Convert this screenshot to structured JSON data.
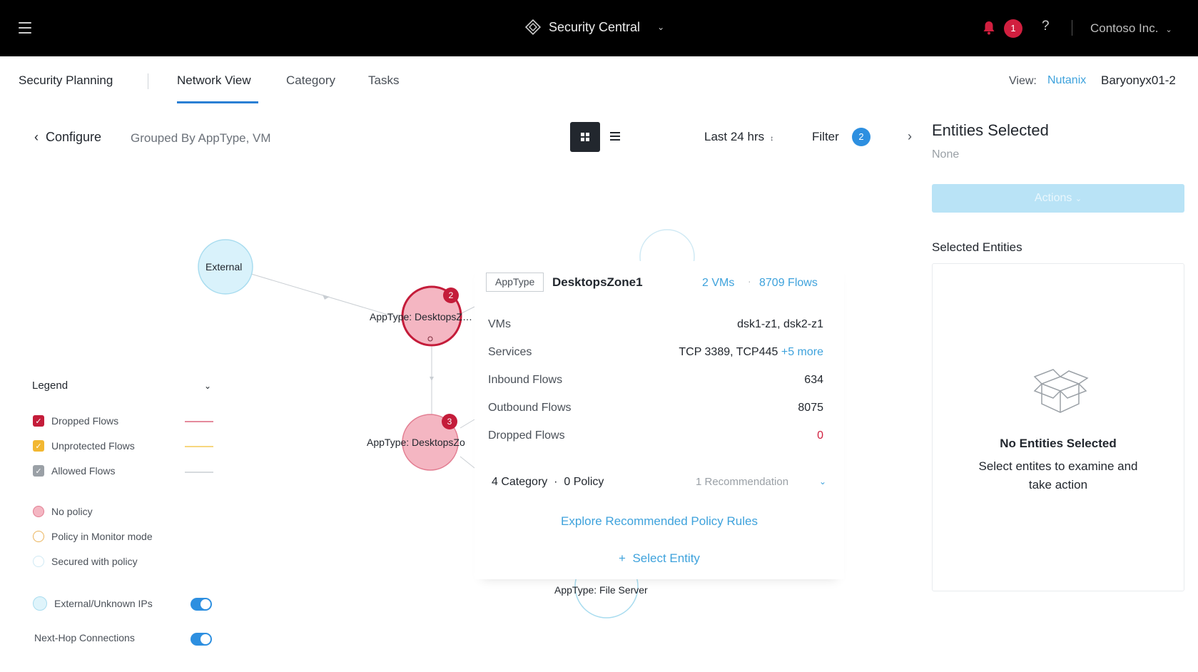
{
  "header": {
    "product": "Security Central",
    "alert_count": "1",
    "help": "?",
    "org": "Contoso Inc."
  },
  "nav": {
    "section": "Security Planning",
    "tabs": [
      "Network View",
      "Category",
      "Tasks"
    ],
    "active_tab": "Network View",
    "view_label": "View:",
    "view_provider": "Nutanix",
    "view_cluster": "Baryonyx01-2"
  },
  "toolbar": {
    "configure": "Configure",
    "grouped_by": "Grouped By AppType, VM",
    "time_range": "Last 24 hrs",
    "filter_label": "Filter",
    "filter_count": "2"
  },
  "graph": {
    "nodes": [
      {
        "label": "External"
      },
      {
        "label": "AppType: DesktopsZ…",
        "badge": "2"
      },
      {
        "label": "AppType: DesktopsZo",
        "badge": "3"
      },
      {
        "label": "AppType: File Server"
      }
    ]
  },
  "legend": {
    "title": "Legend",
    "flows": [
      {
        "label": "Dropped Flows",
        "color": "#c41c3a"
      },
      {
        "label": "Unprotected Flows",
        "color": "#f2b731"
      },
      {
        "label": "Allowed Flows",
        "color": "#9aa0a6"
      }
    ],
    "policies": [
      {
        "label": "No policy",
        "color": "#f4b6c2"
      },
      {
        "label": "Policy in Monitor mode",
        "color": "#f9e0a8"
      },
      {
        "label": "Secured with policy",
        "color": "#dff4fb"
      }
    ],
    "toggles": [
      {
        "label": "External/Unknown IPs",
        "on": true
      },
      {
        "label": "Next-Hop Connections",
        "on": true
      }
    ]
  },
  "popover": {
    "tag": "AppType",
    "name": "DesktopsZone1",
    "vms_link": "2 VMs",
    "flows_link": "8709 Flows",
    "rows": [
      {
        "key": "VMs",
        "value": "dsk1-z1, dsk2-z1"
      },
      {
        "key": "Services",
        "value": "TCP 3389, TCP445",
        "more": "+5 more"
      },
      {
        "key": "Inbound Flows",
        "value": "634"
      },
      {
        "key": "Outbound Flows",
        "value": "8075"
      },
      {
        "key": "Dropped Flows",
        "value": "0"
      }
    ],
    "categories": "4 Category",
    "policies": "0 Policy",
    "recommendation": "1 Recommendation",
    "explore_link": "Explore Recommended Policy Rules",
    "select_entity": "Select Entity"
  },
  "right_panel": {
    "title": "Entities Selected",
    "none": "None",
    "actions": "Actions",
    "selected_title": "Selected Entities",
    "empty_title": "No Entities Selected",
    "empty_desc": "Select entites to examine and take action"
  },
  "colors": {
    "accent": "#3ea2dc",
    "alert": "#d11f3f",
    "topbar": "#000000"
  }
}
